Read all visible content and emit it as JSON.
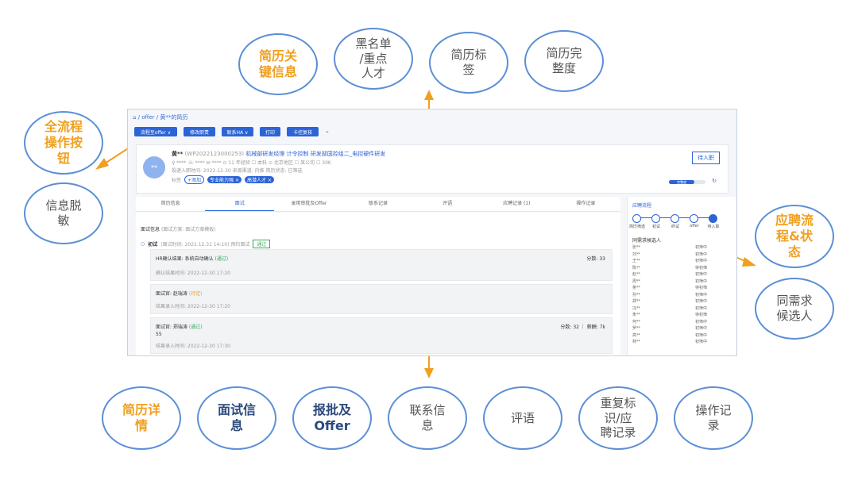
{
  "top_bubbles": [
    {
      "text": "简历关\n键信息",
      "style": "orange"
    },
    {
      "text": "黑名单\n/重点\n人才",
      "style": "gray"
    },
    {
      "text": "简历标\n签",
      "style": "gray"
    },
    {
      "text": "简历完\n整度",
      "style": "gray"
    }
  ],
  "left_bubbles": [
    {
      "text": "全流程\n操作按\n钮",
      "style": "orange"
    },
    {
      "text": "信息脱\n敏",
      "style": "gray"
    }
  ],
  "right_bubbles": [
    {
      "text": "应聘流\n程&状\n态",
      "style": "orange"
    },
    {
      "text": "同需求\n候选人",
      "style": "gray"
    }
  ],
  "bottom_bubbles": [
    {
      "text": "简历详\n情",
      "style": "orange"
    },
    {
      "text": "面试信\n息",
      "style": "dark"
    },
    {
      "text": "报批及\nOffer",
      "style": "dark"
    },
    {
      "text": "联系信\n息",
      "style": "gray"
    },
    {
      "text": "评语",
      "style": "gray"
    },
    {
      "text": "重复标\n识/应\n聘记录",
      "style": "gray"
    },
    {
      "text": "操作记\n录",
      "style": "gray"
    }
  ],
  "screenshot": {
    "breadcrumb": "⌂ / offer / 黄**的简历",
    "toolbar": [
      "流程至offer ∨",
      "修改职责",
      "联系HA ∨",
      "打印",
      "卡控复核"
    ],
    "profile": {
      "avatar": "**",
      "name": "黄**",
      "id": "(WP2022123000253)",
      "line1": "机械部研发经理   计令控制   研发部国控组二_电控硬件研发",
      "line2": "♀ ****   ☏ ****   ✉ ****   ⊙ 11 年经验   ☐ 本科   ⊙ 北京地区   ☐ 某公司   ☐ 30K",
      "line3": "投递入职时间: 2022-12-30   来源渠道: 内推   简历状态: 已筛选",
      "tags_label": "标签",
      "tags": [
        "+添加",
        "专业能力强 ×",
        "高潜人才 ×"
      ],
      "action_button": "待入职",
      "progress_label": "完整度"
    },
    "tabs": [
      "简历信息",
      "面试",
      "录用审批及Offer",
      "联系记录",
      "评语",
      "应聘记录 (1)",
      "操作记录"
    ],
    "active_tab": 1,
    "section_title": "面试信息",
    "section_sub": "(面试方案: 面试方案模板)",
    "round": {
      "title": "初试",
      "meta": "(面试时间: 2022.12.31 14:10)  预约面试",
      "badge": "通过"
    },
    "cards": [
      {
        "title": "HR确认结果: 系统自动确认",
        "status": "(通过)",
        "score": "分数: 33",
        "body": "",
        "time": "确认结果时间: 2022-12-30 17:20"
      },
      {
        "title": "面试官: 赵瑞涛",
        "status": "(待定)",
        "score": "",
        "body": "",
        "time": "结果录入时间: 2022-12-30 17:20"
      },
      {
        "title": "面试官: 郑瑞涛",
        "status": "(通过)",
        "score": "分数: 32 ｜ 薪酬: 7k",
        "body": "55",
        "time": "结果录入时间: 2022-12-30 17:30"
      }
    ],
    "sidebar": {
      "title": "应聘流程",
      "steps": [
        "简历筛选",
        "初试",
        "终试",
        "offer",
        "待入职"
      ],
      "list_title": "同需求候选人",
      "candidates": [
        {
          "name": "张**",
          "status": "初筛中"
        },
        {
          "name": "刘**",
          "status": "初筛中"
        },
        {
          "name": "王**",
          "status": "初筛中"
        },
        {
          "name": "陈**",
          "status": "待初筛"
        },
        {
          "name": "赵**",
          "status": "初筛中"
        },
        {
          "name": "周**",
          "status": "初筛中"
        },
        {
          "name": "吴**",
          "status": "待初筛"
        },
        {
          "name": "孙**",
          "status": "初筛中"
        },
        {
          "name": "郑**",
          "status": "初筛中"
        },
        {
          "name": "冯**",
          "status": "初筛中"
        },
        {
          "name": "朱**",
          "status": "待初筛"
        },
        {
          "name": "何**",
          "status": "初筛中"
        },
        {
          "name": "罗**",
          "status": "初筛中"
        },
        {
          "name": "高**",
          "status": "初筛中"
        },
        {
          "name": "林**",
          "status": "初筛中"
        }
      ]
    }
  },
  "colors": {
    "accent": "#2c64d6",
    "arrow": "#f0a020",
    "bubble_border": "#5b8fd6",
    "orange_text": "#f0a020"
  }
}
